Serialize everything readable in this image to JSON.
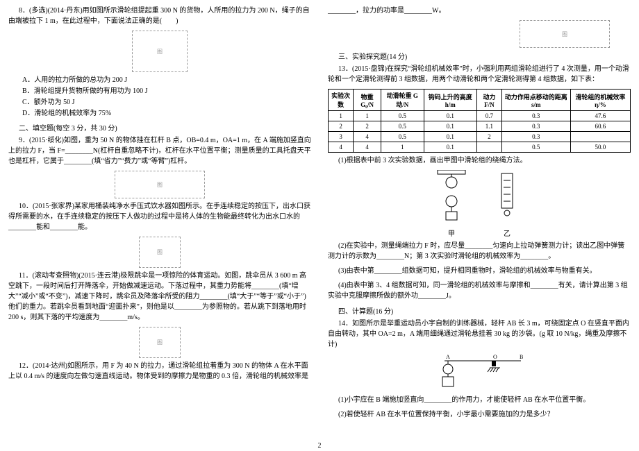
{
  "left": {
    "q8": {
      "stem": "8．(多选)(2014·丹东)用如图所示滑轮组提起重 300 N 的货物，人所用的拉力为 200 N，绳子的自由端被拉下 1 m，在此过程中，下面说法正确的是(　　)",
      "optA": "A．人用的拉力所做的总功为 200 J",
      "optB": "B．滑轮组提升货物所做的有用功为 100 J",
      "optC": "C．额外功为 50 J",
      "optD": "D．滑轮组的机械效率为 75%",
      "img": "图"
    },
    "sec2": "二、填空题(每空 3 分，共 30 分)",
    "q9": "9．(2015·绥化)如图，重为 50 N 的物体挂在杠杆 B 点，OB=0.4 m，OA=1 m，在 A 端施加竖直向上的拉力 F，当 F=________N(杠杆自重忽略不计)，杠杆在水平位置平衡；测量质量的工具托盘天平也是杠杆，它属于________(填“省力”“费力”或“等臂”)杠杆。",
    "q9_img": "图",
    "q10": "10．(2015·张家界)某家用桶装纯净水手压式饮水器如图所示。在手连续稳定的按压下，出水口获得所需要的水，在手连续稳定的按压下人做功的过程中是将人体的生物能最终转化为出水口水的________能和________能。",
    "q10_img": "图",
    "q11": "11．(滚动考查照物)(2015·连云港)极限跳伞是一项惊险的体育运动。如图，跳伞员从 3 600 m 高空跳下，一段时间后打开降落伞，开始做减速运动。下落过程中，其重力势能将________(填“增大”“减小”或“不变”)，减速下降时，跳伞员及降落伞所受的阻力________(填“大于”“等于”或“小于”)他们的重力。若跳伞员看到地面“迎面扑来”，则他是以________为参照物的。若从跳下到落地用时 200 s，则其下落的平均速度为________m/s。",
    "q11_img": "图",
    "q12": "12．(2014·达州)如图所示，用 F 为 40 N 的拉力，通过滑轮组拉着重为 300 N 的物体 A 在水平面上以 0.4 m/s 的速度向左做匀速直线运动。物体受到的摩擦力是物重的 0.3 倍，滑轮组的机械效率是"
  },
  "right": {
    "q12_cont": "________，拉力的功率是________W。",
    "q12_img": "图",
    "sec3": "三、实验探究题(14 分)",
    "q13_stem": "13．(2015·盘锦)在探究“滑轮组机械效率”时，小强利用两组滑轮组进行了 4 次测量，用一个动滑轮和一个定滑轮测得前 3 组数据，用两个动滑轮和两个定滑轮测得第 4 组数据，如下表：",
    "table": {
      "headers": [
        "实验次数",
        "物重 G₀/N",
        "动滑轮重 G动/N",
        "钩码上升的高度 h/m",
        "动力 F/N",
        "动力作用点移动的距离 s/m",
        "滑轮组的机械效率 η/%"
      ],
      "rows": [
        [
          "1",
          "1",
          "0.5",
          "0.1",
          "0.7",
          "0.3",
          "47.6"
        ],
        [
          "2",
          "2",
          "0.5",
          "0.1",
          "1.1",
          "0.3",
          "60.6"
        ],
        [
          "3",
          "4",
          "0.5",
          "0.1",
          "2",
          "0.3",
          ""
        ],
        [
          "4",
          "4",
          "1",
          "0.1",
          "",
          "0.5",
          "50.0"
        ]
      ]
    },
    "q13_1": "(1)根据表中前 3 次实验数据，画出甲图中滑轮组的绕绳方法。",
    "q13_diag_jia": "甲",
    "q13_diag_yi": "乙",
    "q13_2": "(2)在实验中，测量绳端拉力 F 时，应尽量________匀速向上拉动弹簧测力计；读出乙图中弹簧测力计的示数为________N；第 3 次实验时滑轮组的机械效率为________。",
    "q13_3": "(3)由表中第________组数据可知，提升相同重物时，滑轮组的机械效率与物重有关。",
    "q13_4": "(4)由表中第 3、4 组数据可知，同一滑轮组的机械效率与摩擦和________有关，请计算出第 3 组实验中克服摩擦所做的额外功________J。",
    "sec4": "四、计算题(16 分)",
    "q14_stem": "14．如图所示是举重运动员小宇自制的训练器械，轻杆 AB 长 3 m，可绕固定点 O 在竖直平面内自由转动，其中 OA=2 m，A 端用细绳通过滑轮悬挂着 30 kg 的沙袋。(g 取 10 N/kg，绳重及摩擦不计)",
    "q14_img": "图",
    "q14_1": "(1)小宇应在 B 端施加竖直向________的作用力，才能使轻杆 AB 在水平位置平衡。",
    "q14_2": "(2)若使轻杆 AB 在水平位置保持平衡，小宇最小需要施加的力是多少？"
  },
  "page_num": "2"
}
